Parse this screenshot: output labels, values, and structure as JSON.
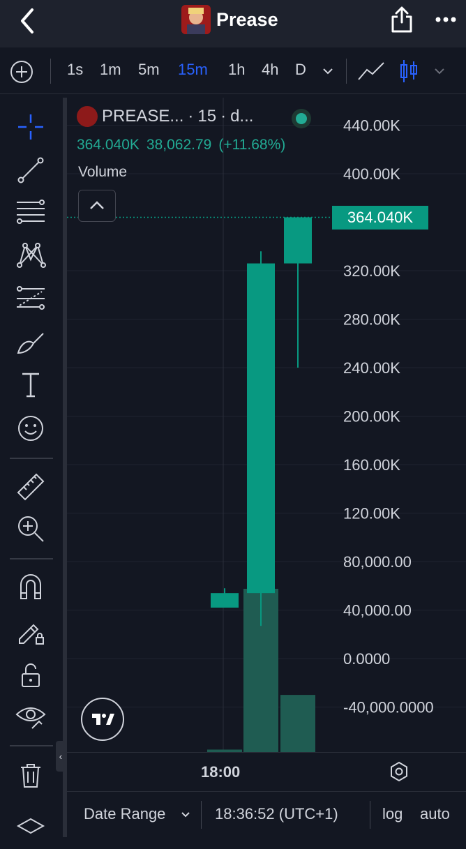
{
  "header": {
    "title": "Prease",
    "back_icon": "back-chevron-icon",
    "share_icon": "share-icon",
    "more_icon": "more-dots-icon"
  },
  "toolbar": {
    "intervals": [
      "1s",
      "1m",
      "5m",
      "15m",
      "1h",
      "4h",
      "D"
    ],
    "active_interval": "15m",
    "active_color": "#2962ff"
  },
  "legend": {
    "symbol": "PREASE...",
    "interval": "15",
    "source": "d...",
    "price": "364.040K",
    "change": "38,062.79",
    "change_pct": "(+11.68%)",
    "volume_label": "Volume"
  },
  "price_tag": "364.040K",
  "footer": {
    "date_range": "Date Range",
    "time": "18:36:52 (UTC+1)",
    "log": "log",
    "auto": "auto"
  },
  "chart_data": {
    "type": "candlestick",
    "y_ticks": [
      "440.00K",
      "400.00K",
      "320.00K",
      "280.00K",
      "240.00K",
      "200.00K",
      "160.00K",
      "120.00K",
      "80,000.00",
      "40,000.00",
      "0.0000",
      "-40,000.0000"
    ],
    "x_ticks": [
      "18:00"
    ],
    "ylim": [
      -72000,
      456000
    ],
    "last_price": 364040,
    "candles": [
      {
        "open": 42000,
        "close": 54000,
        "high": 58000,
        "low": 42000
      },
      {
        "open": 54000,
        "close": 326000,
        "high": 336000,
        "low": 27000
      },
      {
        "open": 326000,
        "close": 364040,
        "high": 364040,
        "low": 240000
      }
    ],
    "volume": [
      1500,
      100000,
      35000
    ],
    "up_color": "#089981"
  }
}
